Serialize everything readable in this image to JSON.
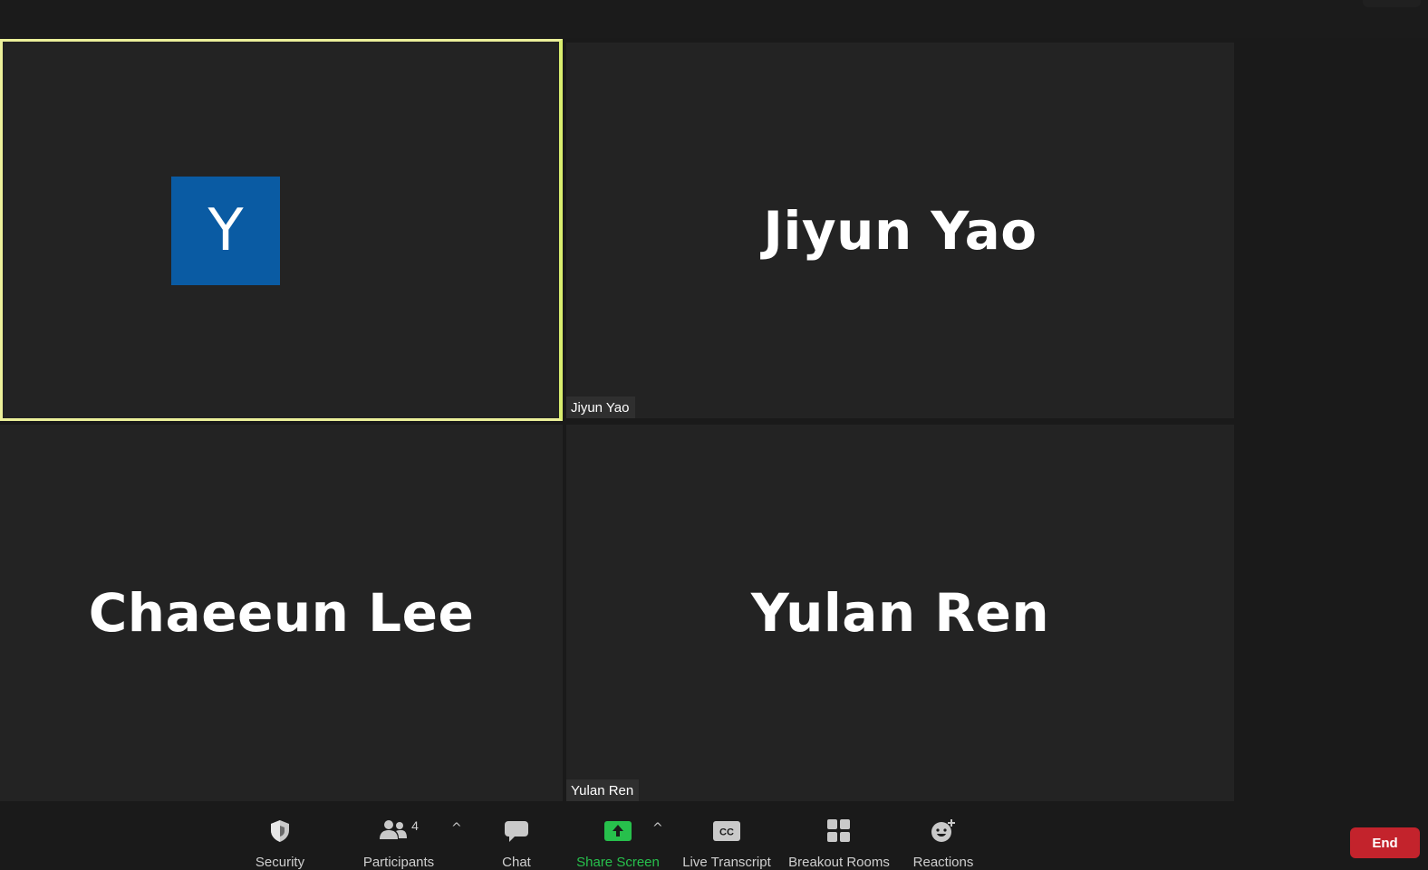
{
  "participants": [
    {
      "id": "self",
      "avatar_letter": "Y",
      "avatar_color": "#0a5ba3",
      "active_speaker": true,
      "active_border_color": "#ecf09a"
    },
    {
      "id": "jiyun",
      "display_name": "Jiyun Yao",
      "nameplate": "Jiyun Yao"
    },
    {
      "id": "chaeeun",
      "display_name": "Chaeeun Lee"
    },
    {
      "id": "yulan",
      "display_name": "Yulan Ren",
      "nameplate": "Yulan Ren"
    }
  ],
  "toolbar": {
    "security": {
      "label": "Security",
      "icon": "shield-icon"
    },
    "participants": {
      "label": "Participants",
      "icon": "people-icon",
      "count": "4"
    },
    "chat": {
      "label": "Chat",
      "icon": "chat-bubble-icon"
    },
    "share_screen": {
      "label": "Share Screen",
      "icon": "share-up-arrow-icon",
      "color": "#27c04c"
    },
    "live_transcript": {
      "label": "Live Transcript",
      "icon": "cc-icon",
      "icon_text": "CC"
    },
    "breakout_rooms": {
      "label": "Breakout Rooms",
      "icon": "grid-icon"
    },
    "reactions": {
      "label": "Reactions",
      "icon": "smiley-plus-icon"
    },
    "end": {
      "label": "End",
      "color": "#c3232c"
    }
  }
}
